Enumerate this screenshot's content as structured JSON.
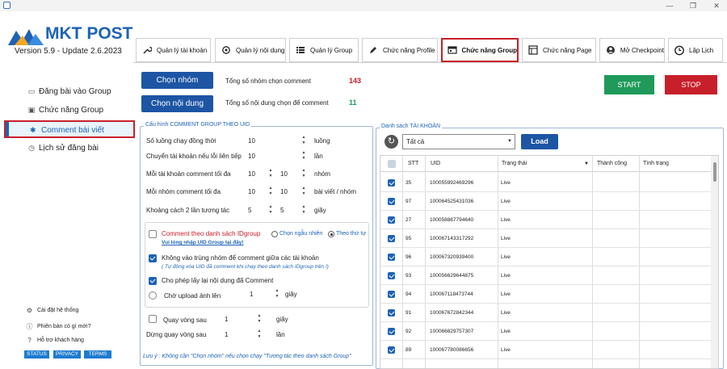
{
  "window": {
    "minimize": "—",
    "maximize": "❐",
    "close": "✕"
  },
  "app": {
    "logo_text": "MKT POST",
    "version": "Version 5.9 - Update 2.6.2023"
  },
  "tabs": [
    {
      "label": "Quản lý tài khoản",
      "icon": "wrench-icon"
    },
    {
      "label": "Quản lý nội dung",
      "icon": "refresh-icon"
    },
    {
      "label": "Quản lý Group",
      "icon": "list-icon"
    },
    {
      "label": "Chức năng Profile",
      "icon": "pencil-icon"
    },
    {
      "label": "Chức năng Group",
      "icon": "window-icon",
      "active": true
    },
    {
      "label": "Chức năng Page",
      "icon": "grid-icon"
    },
    {
      "label": "Mở Checkpoint",
      "icon": "user-circle-icon"
    },
    {
      "label": "Lập Lịch",
      "icon": "clock-icon"
    }
  ],
  "sidebar": {
    "items": [
      {
        "label": "Đăng bài vào Group"
      },
      {
        "label": "Chức năng Group"
      },
      {
        "label": "Comment bài viết",
        "active": true
      },
      {
        "label": "Lịch sử đăng bài"
      }
    ],
    "footer": [
      {
        "label": "Cài đặt hệ thống"
      },
      {
        "label": "Phiên bản có gì mới?"
      },
      {
        "label": "Hỗ trợ khách hàng"
      }
    ],
    "badges": [
      "STATUS",
      "PRIVACY",
      "TERMS"
    ]
  },
  "actions": {
    "choose_group": "Chọn nhóm",
    "choose_content": "Chọn nội dung",
    "total_groups_label": "Tổng số nhóm chọn comment",
    "total_groups_value": "143",
    "total_content_label": "Tổng số nội dung chọn để comment",
    "total_content_value": "11",
    "start": "START",
    "stop": "STOP"
  },
  "config": {
    "title": "Cấu hình COMMENT GROUP THEO UID",
    "threads_label": "Số luồng chạy đồng thời",
    "threads_value": "10",
    "threads_unit": "luồng",
    "switch_label": "Chuyển tài khoản nếu lỗi liên tiếp",
    "switch_value": "10",
    "switch_unit": "lần",
    "max_per_account_label": "Mỗi tài khoản comment tối đa",
    "max_per_account_from": "10",
    "max_per_account_to": "10",
    "max_per_account_unit": "nhóm",
    "max_per_group_label": "Mỗi nhóm comment tối đa",
    "max_per_group_from": "10",
    "max_per_group_to": "10",
    "max_per_group_unit": "bài viết / nhóm",
    "interval_label": "Khoảng cách 2 lần tương tác",
    "interval_from": "5",
    "interval_to": "5",
    "interval_unit": "giây",
    "by_list_label": "Comment theo danh sách IDgroup",
    "random_label": "Chọn ngẫu nhiên",
    "order_label": "Theo thứ tự",
    "import_link": "Vui lòng nhập UID Group tại đây!",
    "no_overlap_label": "Không vào trùng nhóm để comment giữa các tài khoản",
    "no_overlap_note": "( Tự động xóa UID đã comment khi chạy theo danh sách IDgroup trên !)",
    "reuse_label": "Cho phép lấy lại nội dung đã Comment",
    "wait_upload_label": "Chờ upload ảnh lên",
    "wait_upload_value": "1",
    "wait_upload_unit": "giây",
    "loop_label": "Quay vòng sau",
    "loop_value": "1",
    "loop_unit": "giây",
    "stop_loop_label": "Dừng quay vòng sau",
    "stop_loop_value": "1",
    "stop_loop_unit": "lần",
    "note": "Lưu ý : Không cần \"Chọn nhóm\" nếu chọn chạy \"Tương tác theo danh sách Group\""
  },
  "accounts": {
    "title": "Danh sách TÀI KHOẢN",
    "filter": "Tất cả",
    "load": "Load",
    "columns": [
      "STT",
      "UID",
      "Trạng thái",
      "Thành công",
      "Tình trạng"
    ],
    "rows": [
      {
        "stt": "35",
        "uid": "100055992469296",
        "status": "Live"
      },
      {
        "stt": "97",
        "uid": "100064525431036",
        "status": "Live"
      },
      {
        "stt": "27",
        "uid": "100058887794640",
        "status": "Live"
      },
      {
        "stt": "95",
        "uid": "100067143317292",
        "status": "Live"
      },
      {
        "stt": "96",
        "uid": "100067320939400",
        "status": "Live"
      },
      {
        "stt": "93",
        "uid": "100056629644875",
        "status": "Live"
      },
      {
        "stt": "94",
        "uid": "100067118473744",
        "status": "Live"
      },
      {
        "stt": "91",
        "uid": "100067672842344",
        "status": "Live"
      },
      {
        "stt": "92",
        "uid": "100066829757307",
        "status": "Live"
      },
      {
        "stt": "89",
        "uid": "100067780086656",
        "status": "Live"
      }
    ]
  },
  "colors": {
    "accent": "#1d55a4",
    "danger": "#c8202a",
    "success": "#1f9a5a"
  }
}
